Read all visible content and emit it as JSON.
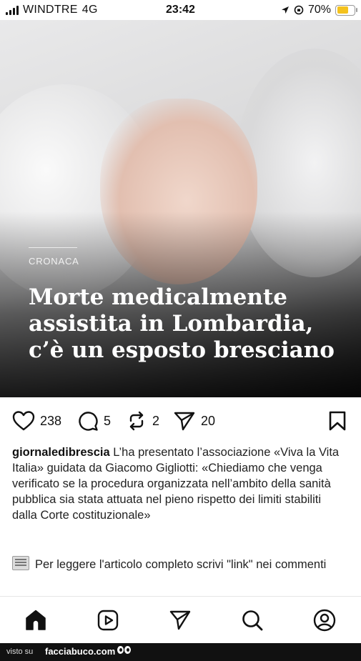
{
  "status_bar": {
    "carrier": "WINDTRE",
    "network": "4G",
    "time": "23:42",
    "battery_percent": "70%",
    "battery_level": 0.7
  },
  "post": {
    "category": "CRONACA",
    "headline": "Morte medicalmente assistita in Lombardia, c’è un esposto bresciano",
    "likes": "238",
    "comments": "5",
    "reposts": "2",
    "shares": "20",
    "username": "giornaledibrescia",
    "caption": "L’ha presentato l’associazione «Viva la Vita Italia» guidata da Giacomo Gigliotti: «Chiediamo che venga verificato se la procedura organizzata nell’ambito della sanità pubblica sia stata attuata nel pieno rispetto dei limiti stabiliti dalla Corte costituzionale»",
    "note": "Per leggere l'articolo completo scrivi \"link\" nei commenti"
  },
  "nav": {
    "items": [
      "home-icon",
      "reels-icon",
      "direct-icon",
      "search-icon",
      "profile-icon"
    ]
  },
  "watermark": {
    "prefix": "visto su",
    "site": "facciabuco.com"
  }
}
